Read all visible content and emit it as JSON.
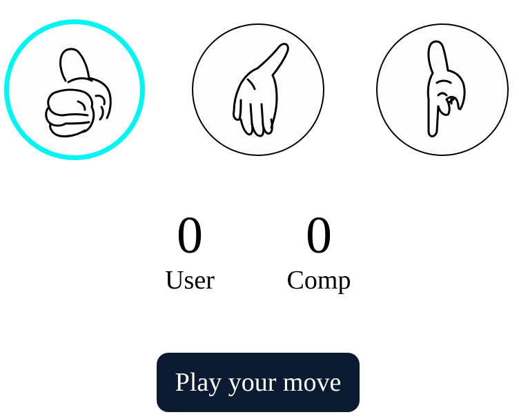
{
  "choices": [
    {
      "id": "rock",
      "icon": "rock-fist-icon",
      "selected": true
    },
    {
      "id": "paper",
      "icon": "paper-hand-icon",
      "selected": false
    },
    {
      "id": "scissors",
      "icon": "scissors-hand-icon",
      "selected": false
    }
  ],
  "scoreboard": {
    "user": {
      "score": "0",
      "label": "User"
    },
    "comp": {
      "score": "0",
      "label": "Comp"
    }
  },
  "play_button": {
    "label": "Play your move"
  },
  "colors": {
    "selected_ring": "#00f5f5",
    "button_bg": "#0b1a30",
    "button_text": "#ffffff"
  }
}
